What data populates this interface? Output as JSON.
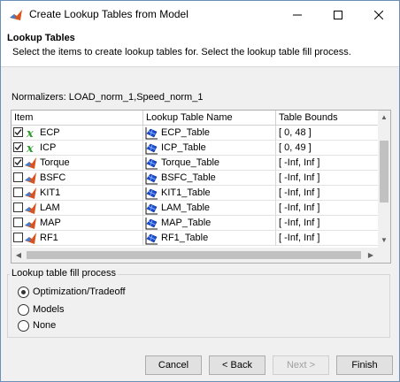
{
  "window": {
    "title": "Create Lookup Tables from Model"
  },
  "header": {
    "title": "Lookup Tables",
    "description": "Select the items to create lookup tables for. Select the lookup table fill process."
  },
  "normalizers": "Normalizers: LOAD_norm_1,Speed_norm_1",
  "table": {
    "columns": [
      "Item",
      "Lookup Table Name",
      "Table Bounds"
    ],
    "rows": [
      {
        "checked": true,
        "icon": "variable-x-icon",
        "item": "ECP",
        "table_name": "ECP_Table",
        "bounds": "[ 0, 48 ]"
      },
      {
        "checked": true,
        "icon": "variable-x-icon",
        "item": "ICP",
        "table_name": "ICP_Table",
        "bounds": "[ 0, 49 ]"
      },
      {
        "checked": true,
        "icon": "model-surface-icon",
        "item": "Torque",
        "table_name": "Torque_Table",
        "bounds": "[ -Inf, Inf ]"
      },
      {
        "checked": false,
        "icon": "model-surface-icon",
        "item": "BSFC",
        "table_name": "BSFC_Table",
        "bounds": "[ -Inf, Inf ]"
      },
      {
        "checked": false,
        "icon": "model-surface-icon",
        "item": "KIT1",
        "table_name": "KIT1_Table",
        "bounds": "[ -Inf, Inf ]"
      },
      {
        "checked": false,
        "icon": "model-surface-icon",
        "item": "LAM",
        "table_name": "LAM_Table",
        "bounds": "[ -Inf, Inf ]"
      },
      {
        "checked": false,
        "icon": "model-surface-icon",
        "item": "MAP",
        "table_name": "MAP_Table",
        "bounds": "[ -Inf, Inf ]"
      },
      {
        "checked": false,
        "icon": "model-surface-icon",
        "item": "RF1",
        "table_name": "RF1_Table",
        "bounds": "[ -Inf, Inf ]"
      }
    ]
  },
  "fill_process": {
    "title": "Lookup table fill process",
    "options": [
      "Optimization/Tradeoff",
      "Models",
      "None"
    ],
    "selected": "Optimization/Tradeoff"
  },
  "buttons": {
    "cancel": "Cancel",
    "back": "< Back",
    "next": "Next >",
    "finish": "Finish"
  },
  "colors": {
    "accent_blue": "#1a4fd8",
    "matlab_orange": "#d9531e",
    "variable_green": "#2e9a2e"
  }
}
